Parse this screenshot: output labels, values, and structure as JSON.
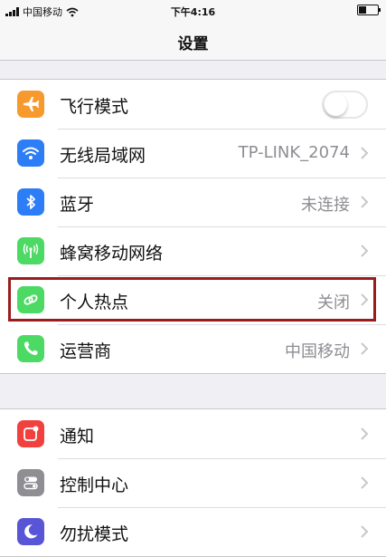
{
  "status_bar": {
    "carrier": "中国移动",
    "time": "下午4:16",
    "battery_level": 0.35
  },
  "header": {
    "title": "设置"
  },
  "colors": {
    "airplane": "#f79a2e",
    "wifi": "#2d7df6",
    "bluetooth": "#2d7df6",
    "cellular": "#4cd964",
    "hotspot": "#4cd964",
    "carrier": "#4cd964",
    "notifications": "#f0413e",
    "control_center": "#8e8e93",
    "dnd": "#5856d6",
    "highlight": "#9b1c1c"
  },
  "settings": {
    "airplane": {
      "label": "飞行模式",
      "icon": "airplane-icon",
      "toggle_on": false
    },
    "wifi": {
      "label": "无线局域网",
      "value": "TP-LINK_2074",
      "icon": "wifi-icon"
    },
    "bluetooth": {
      "label": "蓝牙",
      "value": "未连接",
      "icon": "bluetooth-icon"
    },
    "cellular": {
      "label": "蜂窝移动网络",
      "icon": "cellular-antenna-icon"
    },
    "hotspot": {
      "label": "个人热点",
      "value": "关闭",
      "icon": "hotspot-chain-icon"
    },
    "carrier": {
      "label": "运营商",
      "value": "中国移动",
      "icon": "phone-icon"
    },
    "notifications": {
      "label": "通知",
      "icon": "notifications-icon"
    },
    "control_center": {
      "label": "控制中心",
      "icon": "control-center-icon"
    },
    "dnd": {
      "label": "勿扰模式",
      "icon": "moon-icon"
    }
  }
}
